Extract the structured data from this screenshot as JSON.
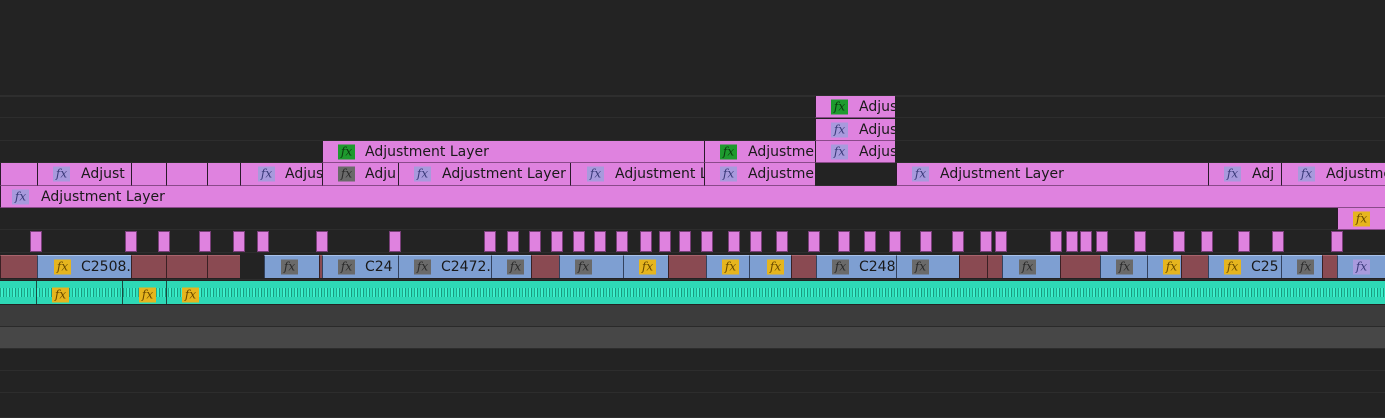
{
  "colors": {
    "adjustment": "#df82df",
    "video_red": "#8a4a52",
    "video_blue": "#7e9fd2",
    "audio": "#2ed8b6",
    "fx_purple": "#a89add",
    "fx_green": "#1e9a2e",
    "fx_gray": "#6a6a6a",
    "fx_yellow": "#e6b51e",
    "background": "#232323"
  },
  "fx_label": "fx",
  "v9_clips": [
    {
      "label": "Adjus",
      "fx": "green"
    }
  ],
  "v8_clips": [
    {
      "label": "Adjus",
      "fx": "purple"
    }
  ],
  "v7_clips": [
    {
      "label": "Adjustment Layer",
      "fx": "green"
    },
    {
      "label": "Adjustme",
      "fx": "green"
    },
    {
      "label": "Adjus",
      "fx": "purple"
    }
  ],
  "v6_clips": [
    {
      "label": "",
      "fx": ""
    },
    {
      "label": "Adjust",
      "fx": "purple"
    },
    {
      "label": "",
      "fx": ""
    },
    {
      "label": "",
      "fx": ""
    },
    {
      "label": "",
      "fx": ""
    },
    {
      "label": "Adjus",
      "fx": "purple"
    },
    {
      "label": "Adju",
      "fx": "gray"
    },
    {
      "label": "Adjustment Layer",
      "fx": "purple"
    },
    {
      "label": "",
      "fx": ""
    },
    {
      "label": "Adjustment La",
      "fx": "purple"
    },
    {
      "label": "Adjustme",
      "fx": "purple"
    },
    {
      "label": "Adjustment Layer",
      "fx": "purple"
    },
    {
      "label": "",
      "fx": ""
    },
    {
      "label": "Adj",
      "fx": "purple"
    },
    {
      "label": "Adjustme",
      "fx": "purple"
    }
  ],
  "v5_clips": [
    {
      "label": "Adjustment Layer",
      "fx": "purple"
    }
  ],
  "v4_clips": [
    {
      "label": "",
      "fx": "yellow"
    }
  ],
  "v2_clips": [
    {
      "label": "",
      "fx": ""
    },
    {
      "label": "C2508.",
      "fx": "yellow"
    },
    {
      "label": "",
      "fx": ""
    },
    {
      "label": "",
      "fx": ""
    },
    {
      "label": "",
      "fx": ""
    },
    {
      "label": "",
      "fx": "gray"
    },
    {
      "label": "",
      "fx": ""
    },
    {
      "label": "C24",
      "fx": "gray"
    },
    {
      "label": "C2472.",
      "fx": "gray"
    },
    {
      "label": "",
      "fx": "gray"
    },
    {
      "label": "",
      "fx": ""
    },
    {
      "label": "",
      "fx": "gray"
    },
    {
      "label": "",
      "fx": "yellow"
    },
    {
      "label": "",
      "fx": ""
    },
    {
      "label": "",
      "fx": "yellow"
    },
    {
      "label": "",
      "fx": "yellow"
    },
    {
      "label": "",
      "fx": ""
    },
    {
      "label": "C248",
      "fx": "gray"
    },
    {
      "label": "",
      "fx": "gray"
    },
    {
      "label": "",
      "fx": ""
    },
    {
      "label": "",
      "fx": ""
    },
    {
      "label": "",
      "fx": "gray"
    },
    {
      "label": "",
      "fx": ""
    },
    {
      "label": "",
      "fx": "gray"
    },
    {
      "label": "",
      "fx": "yellow"
    },
    {
      "label": "",
      "fx": ""
    },
    {
      "label": "C25",
      "fx": "yellow"
    },
    {
      "label": "",
      "fx": "gray"
    },
    {
      "label": "",
      "fx": ""
    },
    {
      "label": "",
      "fx": "purple"
    }
  ],
  "a1_fx": [
    "yellow",
    "yellow",
    "yellow"
  ]
}
